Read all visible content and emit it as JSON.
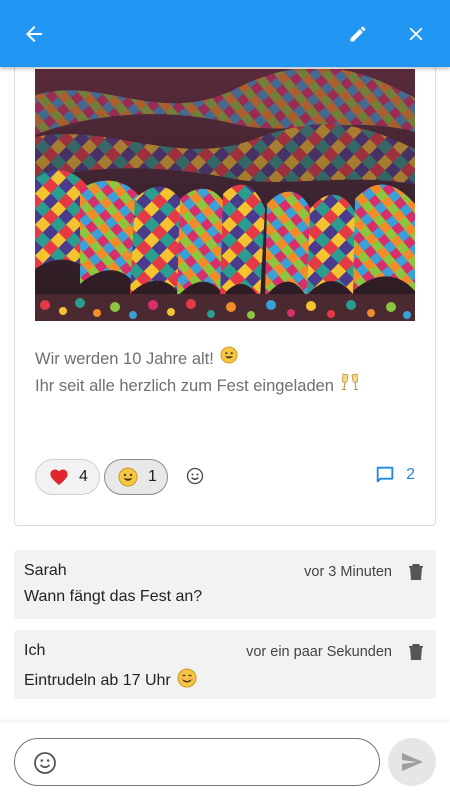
{
  "header": {
    "back_icon": "arrow-left-icon",
    "edit_icon": "pencil-icon",
    "close_icon": "close-icon",
    "color": "#2196f3"
  },
  "post": {
    "image": "party-streamers-photo",
    "text_line1": "Wir werden 10 Jahre alt!",
    "text_line1_emoji": "grinning-face-emoji",
    "text_line2": "Ihr seit alle herzlich zum Fest eingeladen",
    "text_line2_emoji": "clinking-glasses-emoji"
  },
  "reactions": [
    {
      "icon": "heart-emoji",
      "count": "4",
      "selected": false
    },
    {
      "icon": "grinning-face-emoji",
      "count": "1",
      "selected": true
    }
  ],
  "add_reaction_icon": "smiley-outline-icon",
  "comments_link": {
    "icon": "comment-icon",
    "count": "2",
    "color": "#1e88e5"
  },
  "comments": [
    {
      "author": "Sarah",
      "time": "vor 3 Minuten",
      "text": "Wann fängt das Fest an?",
      "emoji": ""
    },
    {
      "author": "Ich",
      "time": "vor ein paar Sekunden",
      "text": "Eintrudeln ab 17 Uhr",
      "emoji": "smiling-face-emoji"
    }
  ],
  "composer": {
    "value": "",
    "placeholder": "",
    "emoji_icon": "smiley-outline-icon",
    "send_icon": "send-icon"
  }
}
